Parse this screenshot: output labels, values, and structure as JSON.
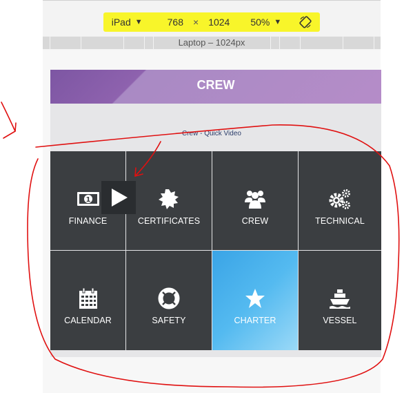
{
  "devtools": {
    "device": "iPad",
    "width": "768",
    "times": "×",
    "height": "1024",
    "zoom": "50%",
    "media_query_label": "Laptop – 1024px"
  },
  "app": {
    "banner_title": "CREW",
    "video_link": "Crew - Quick Video",
    "tiles": [
      {
        "label": "FINANCE",
        "icon": "money-icon"
      },
      {
        "label": "CERTIFICATES",
        "icon": "certificate-icon"
      },
      {
        "label": "CREW",
        "icon": "users-icon"
      },
      {
        "label": "TECHNICAL",
        "icon": "cogs-icon"
      },
      {
        "label": "CALENDAR",
        "icon": "calendar-icon"
      },
      {
        "label": "SAFETY",
        "icon": "life-ring-icon"
      },
      {
        "label": "CHARTER",
        "icon": "star-icon",
        "active": true
      },
      {
        "label": "VESSEL",
        "icon": "ship-icon"
      }
    ]
  },
  "colors": {
    "highlight": "#f8f52a",
    "banner": "#8e62ae",
    "tile": "#3b3e41",
    "active_tile": "#54baf0",
    "annotation": "#e01010"
  }
}
